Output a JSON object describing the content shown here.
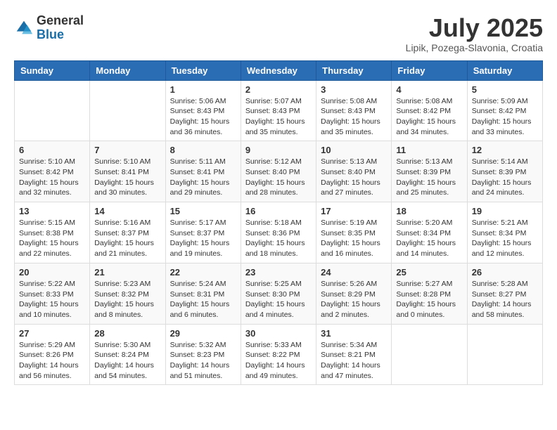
{
  "header": {
    "logo": {
      "general": "General",
      "blue": "Blue"
    },
    "title": "July 2025",
    "subtitle": "Lipik, Pozega-Slavonia, Croatia"
  },
  "calendar": {
    "days_of_week": [
      "Sunday",
      "Monday",
      "Tuesday",
      "Wednesday",
      "Thursday",
      "Friday",
      "Saturday"
    ],
    "weeks": [
      [
        {
          "day": "",
          "info": ""
        },
        {
          "day": "",
          "info": ""
        },
        {
          "day": "1",
          "info": "Sunrise: 5:06 AM\nSunset: 8:43 PM\nDaylight: 15 hours and 36 minutes."
        },
        {
          "day": "2",
          "info": "Sunrise: 5:07 AM\nSunset: 8:43 PM\nDaylight: 15 hours and 35 minutes."
        },
        {
          "day": "3",
          "info": "Sunrise: 5:08 AM\nSunset: 8:43 PM\nDaylight: 15 hours and 35 minutes."
        },
        {
          "day": "4",
          "info": "Sunrise: 5:08 AM\nSunset: 8:42 PM\nDaylight: 15 hours and 34 minutes."
        },
        {
          "day": "5",
          "info": "Sunrise: 5:09 AM\nSunset: 8:42 PM\nDaylight: 15 hours and 33 minutes."
        }
      ],
      [
        {
          "day": "6",
          "info": "Sunrise: 5:10 AM\nSunset: 8:42 PM\nDaylight: 15 hours and 32 minutes."
        },
        {
          "day": "7",
          "info": "Sunrise: 5:10 AM\nSunset: 8:41 PM\nDaylight: 15 hours and 30 minutes."
        },
        {
          "day": "8",
          "info": "Sunrise: 5:11 AM\nSunset: 8:41 PM\nDaylight: 15 hours and 29 minutes."
        },
        {
          "day": "9",
          "info": "Sunrise: 5:12 AM\nSunset: 8:40 PM\nDaylight: 15 hours and 28 minutes."
        },
        {
          "day": "10",
          "info": "Sunrise: 5:13 AM\nSunset: 8:40 PM\nDaylight: 15 hours and 27 minutes."
        },
        {
          "day": "11",
          "info": "Sunrise: 5:13 AM\nSunset: 8:39 PM\nDaylight: 15 hours and 25 minutes."
        },
        {
          "day": "12",
          "info": "Sunrise: 5:14 AM\nSunset: 8:39 PM\nDaylight: 15 hours and 24 minutes."
        }
      ],
      [
        {
          "day": "13",
          "info": "Sunrise: 5:15 AM\nSunset: 8:38 PM\nDaylight: 15 hours and 22 minutes."
        },
        {
          "day": "14",
          "info": "Sunrise: 5:16 AM\nSunset: 8:37 PM\nDaylight: 15 hours and 21 minutes."
        },
        {
          "day": "15",
          "info": "Sunrise: 5:17 AM\nSunset: 8:37 PM\nDaylight: 15 hours and 19 minutes."
        },
        {
          "day": "16",
          "info": "Sunrise: 5:18 AM\nSunset: 8:36 PM\nDaylight: 15 hours and 18 minutes."
        },
        {
          "day": "17",
          "info": "Sunrise: 5:19 AM\nSunset: 8:35 PM\nDaylight: 15 hours and 16 minutes."
        },
        {
          "day": "18",
          "info": "Sunrise: 5:20 AM\nSunset: 8:34 PM\nDaylight: 15 hours and 14 minutes."
        },
        {
          "day": "19",
          "info": "Sunrise: 5:21 AM\nSunset: 8:34 PM\nDaylight: 15 hours and 12 minutes."
        }
      ],
      [
        {
          "day": "20",
          "info": "Sunrise: 5:22 AM\nSunset: 8:33 PM\nDaylight: 15 hours and 10 minutes."
        },
        {
          "day": "21",
          "info": "Sunrise: 5:23 AM\nSunset: 8:32 PM\nDaylight: 15 hours and 8 minutes."
        },
        {
          "day": "22",
          "info": "Sunrise: 5:24 AM\nSunset: 8:31 PM\nDaylight: 15 hours and 6 minutes."
        },
        {
          "day": "23",
          "info": "Sunrise: 5:25 AM\nSunset: 8:30 PM\nDaylight: 15 hours and 4 minutes."
        },
        {
          "day": "24",
          "info": "Sunrise: 5:26 AM\nSunset: 8:29 PM\nDaylight: 15 hours and 2 minutes."
        },
        {
          "day": "25",
          "info": "Sunrise: 5:27 AM\nSunset: 8:28 PM\nDaylight: 15 hours and 0 minutes."
        },
        {
          "day": "26",
          "info": "Sunrise: 5:28 AM\nSunset: 8:27 PM\nDaylight: 14 hours and 58 minutes."
        }
      ],
      [
        {
          "day": "27",
          "info": "Sunrise: 5:29 AM\nSunset: 8:26 PM\nDaylight: 14 hours and 56 minutes."
        },
        {
          "day": "28",
          "info": "Sunrise: 5:30 AM\nSunset: 8:24 PM\nDaylight: 14 hours and 54 minutes."
        },
        {
          "day": "29",
          "info": "Sunrise: 5:32 AM\nSunset: 8:23 PM\nDaylight: 14 hours and 51 minutes."
        },
        {
          "day": "30",
          "info": "Sunrise: 5:33 AM\nSunset: 8:22 PM\nDaylight: 14 hours and 49 minutes."
        },
        {
          "day": "31",
          "info": "Sunrise: 5:34 AM\nSunset: 8:21 PM\nDaylight: 14 hours and 47 minutes."
        },
        {
          "day": "",
          "info": ""
        },
        {
          "day": "",
          "info": ""
        }
      ]
    ]
  }
}
